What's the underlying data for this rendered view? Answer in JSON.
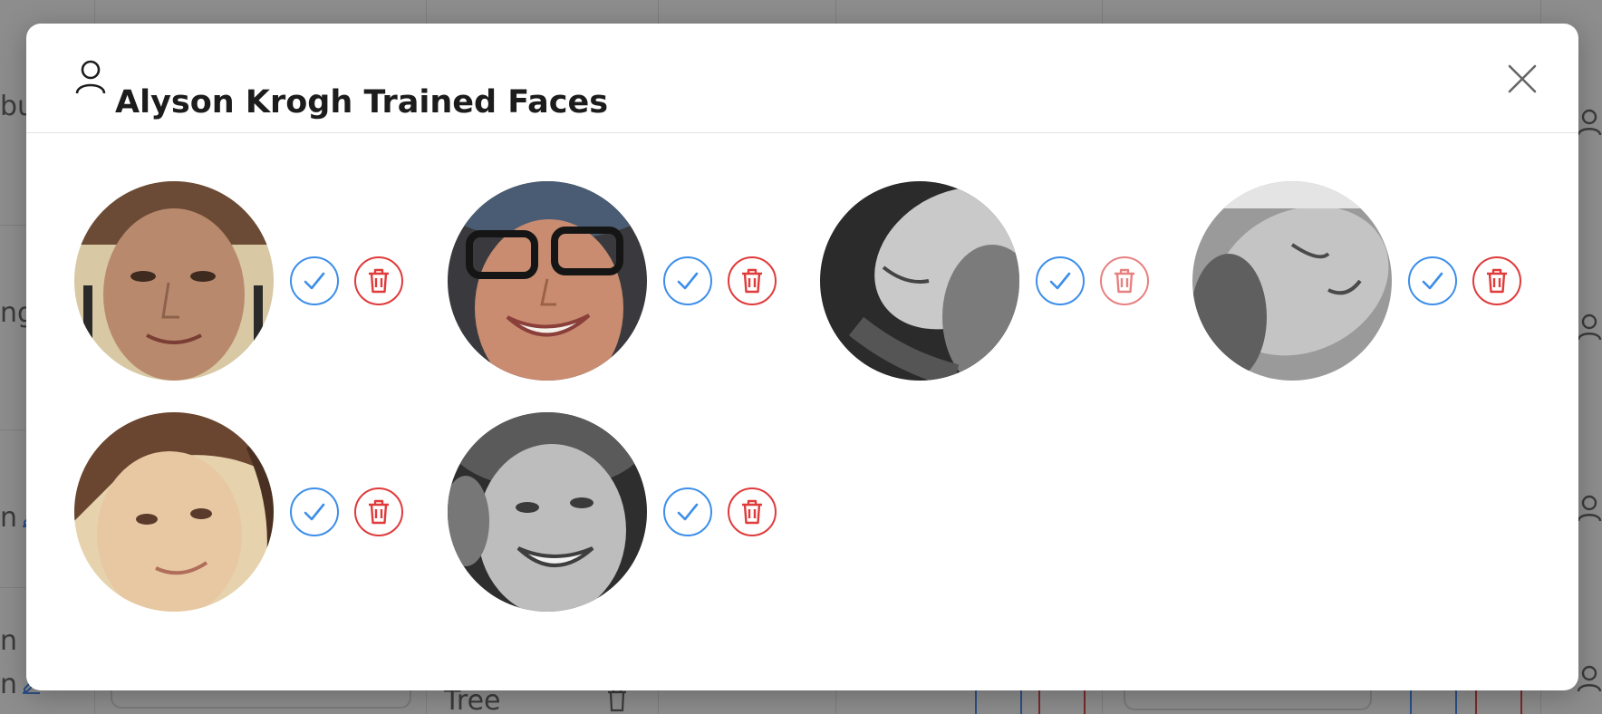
{
  "colors": {
    "confirm": "#3d8eea",
    "remove": "#e03a3a",
    "title_text": "#1c1c1c",
    "overlay": "#8d8d8d"
  },
  "background": {
    "fragments": [
      "bu",
      "ng",
      "n",
      "n",
      "n",
      "Tree"
    ]
  },
  "modal": {
    "title_icon": "user-icon",
    "title": "Alyson Krogh Trained Faces",
    "close_icon": "close-icon"
  },
  "faces": [
    {
      "tone": "color-warm",
      "confirm_icon": "check-icon",
      "remove_icon": "trash-icon"
    },
    {
      "tone": "color-warm",
      "confirm_icon": "check-icon",
      "remove_icon": "trash-icon"
    },
    {
      "tone": "grayscale",
      "confirm_icon": "check-icon",
      "remove_icon": "trash-icon"
    },
    {
      "tone": "grayscale",
      "confirm_icon": "check-icon",
      "remove_icon": "trash-icon"
    },
    {
      "tone": "color-pale",
      "confirm_icon": "check-icon",
      "remove_icon": "trash-icon"
    },
    {
      "tone": "grayscale",
      "confirm_icon": "check-icon",
      "remove_icon": "trash-icon"
    }
  ]
}
